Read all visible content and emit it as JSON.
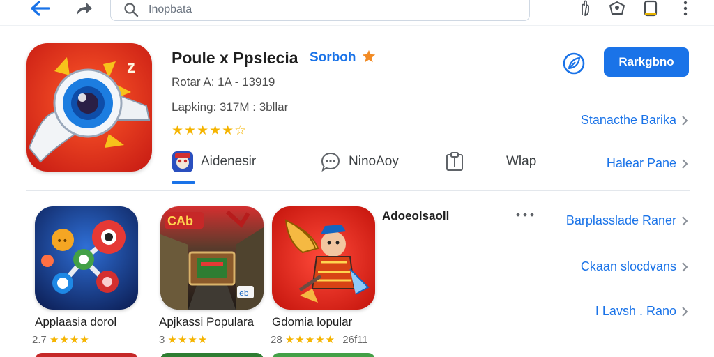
{
  "toolbar": {
    "search_placeholder": "Inopbata",
    "icons": [
      "back-arrow-icon",
      "share-icon",
      "search-icon",
      "hand-icon",
      "badge-icon",
      "bookmark-icon",
      "more-vertical-icon"
    ]
  },
  "app": {
    "title": "Poule x Ppslecia",
    "developer": "Sorboh",
    "meta_line1": "Rotar A: 1A - 13919",
    "meta_line2": "Lapking: 317M : 3bllar",
    "rating_stars": "★★★★★☆",
    "install_label": "Rarkgbno"
  },
  "side_links": [
    {
      "label": "Stanacthe Barika"
    },
    {
      "label": "Halear Pane"
    },
    {
      "label": "Barplasslade Raner"
    },
    {
      "label": "Ckaan slocdvans"
    },
    {
      "label": "I Lavsh .  Rano"
    }
  ],
  "tabs": [
    {
      "label": "Aidenesir",
      "icon": "app-avatar-icon",
      "active": true
    },
    {
      "label": "NinoAoy",
      "icon": "chat-bubble-icon",
      "active": false
    },
    {
      "label": "",
      "icon": "clipboard-icon",
      "active": false
    },
    {
      "label": "Wlap",
      "icon": "",
      "active": false
    }
  ],
  "section": {
    "title": "Adoeolsaoll"
  },
  "cards": [
    {
      "name": "Applaasia dorol",
      "rating_value": "2.7",
      "stars": "★★★★",
      "extra": ""
    },
    {
      "name": "Apjkassi Populara",
      "rating_value": "3",
      "stars": "★★★★",
      "extra": ""
    },
    {
      "name": "Gdomia lopular",
      "rating_value": "28",
      "stars": "★★★★★",
      "extra": "26f11"
    }
  ],
  "colors": {
    "accent": "#1a73e8",
    "star": "#f5b400",
    "orange_star": "#f28b24",
    "main_icon_bg": "#e53a22"
  }
}
